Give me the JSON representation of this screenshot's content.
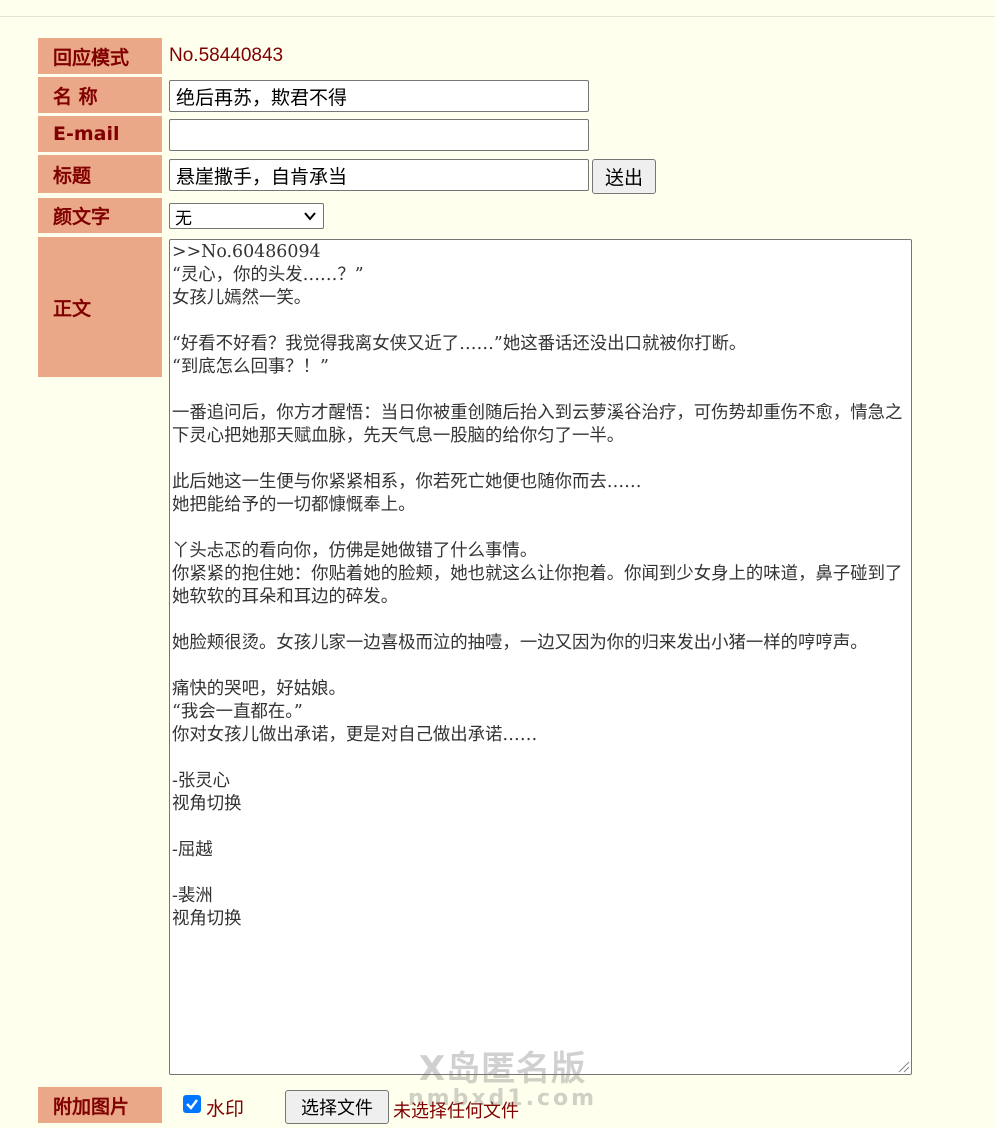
{
  "form": {
    "reply_mode": {
      "label": "回应模式",
      "value": "No.58440843"
    },
    "name": {
      "label": "名 称",
      "value": "绝后再苏，欺君不得"
    },
    "email": {
      "label": "E-mail",
      "value": ""
    },
    "title": {
      "label": "标题",
      "value": "悬崖撒手，自肯承当"
    },
    "submit_label": "送出",
    "kaomoji": {
      "label": "颜文字",
      "selected": "无"
    },
    "body": {
      "label": "正文",
      "value": ">>No.60486094\n“灵心，你的头发……？”\n女孩儿嫣然一笑。\n\n“好看不好看？我觉得我离女侠又近了……”她这番话还没出口就被你打断。\n“到底怎么回事？！”\n\n一番追问后，你方才醒悟：当日你被重创随后抬入到云萝溪谷治疗，可伤势却重伤不愈，情急之下灵心把她那天赋血脉，先天气息一股脑的给你匀了一半。\n\n此后她这一生便与你紧紧相系，你若死亡她便也随你而去……\n她把能给予的一切都慷慨奉上。\n\n丫头忐忑的看向你，仿佛是她做错了什么事情。\n你紧紧的抱住她：你贴着她的脸颊，她也就这么让你抱着。你闻到少女身上的味道，鼻子碰到了她软软的耳朵和耳边的碎发。\n\n她脸颊很烫。女孩儿家一边喜极而泣的抽噎，一边又因为你的归来发出小猪一样的哼哼声。\n\n痛快的哭吧，好姑娘。\n“我会一直都在。”\n你对女孩儿做出承诺，更是对自己做出承诺……\n\n-张灵心\n视角切换\n\n-屈越\n\n-裴洲\n视角切换"
    },
    "attach": {
      "label": "附加图片",
      "watermark_label": "水印",
      "watermark_checked": true,
      "choose_file_label": "选择文件",
      "no_file_text": "未选择任何文件"
    }
  },
  "overlay_watermark": {
    "line1": "X岛匿名版",
    "line2": "nmbxd1.com"
  },
  "colors": {
    "background": "#ffffee",
    "label_bg": "#eaa888",
    "text": "#800000",
    "checkbox": "#0075ff"
  }
}
